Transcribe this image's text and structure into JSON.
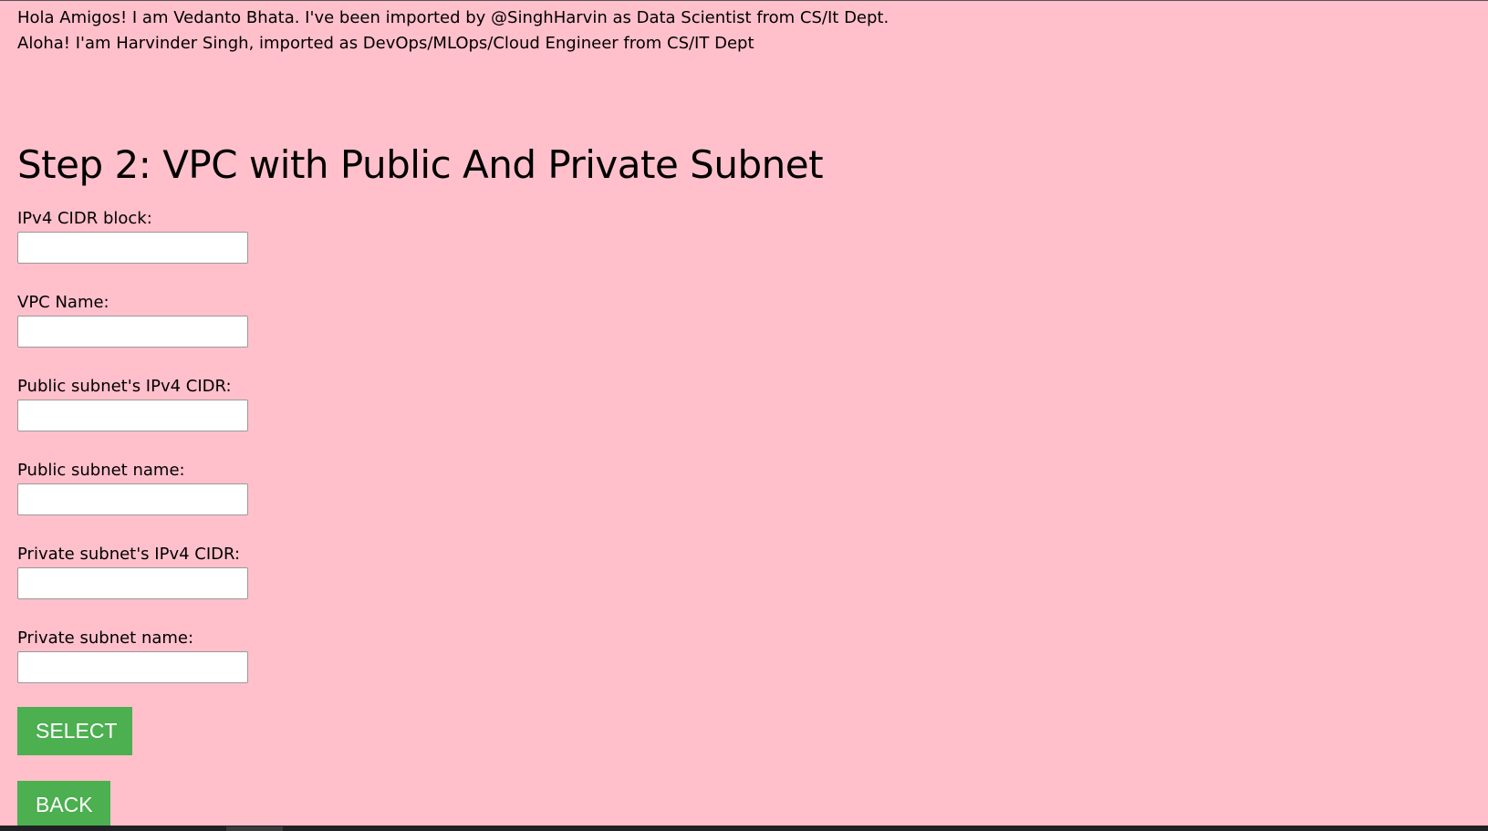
{
  "intro": {
    "line1": "Hola Amigos! I am Vedanto Bhata. I've been imported by @SinghHarvin as Data Scientist from CS/It Dept.",
    "line2": "Aloha! I'am Harvinder Singh, imported as DevOps/MLOps/Cloud Engineer from CS/IT Dept"
  },
  "page_title": "Step 2: VPC with Public And Private Subnet",
  "form": {
    "fields": [
      {
        "label": "IPv4 CIDR block:",
        "value": "",
        "placeholder": ""
      },
      {
        "label": "VPC Name:",
        "value": "",
        "placeholder": ""
      },
      {
        "label": "Public subnet's IPv4 CIDR:",
        "value": "",
        "placeholder": ""
      },
      {
        "label": "Public subnet name:",
        "value": "",
        "placeholder": ""
      },
      {
        "label": "Private subnet's IPv4 CIDR:",
        "value": "",
        "placeholder": ""
      },
      {
        "label": "Private subnet name:",
        "value": "",
        "placeholder": ""
      }
    ]
  },
  "buttons": {
    "select_label": "SELECT",
    "back_label": "BACK"
  },
  "colors": {
    "background": "#ffc0cb",
    "button": "#4caf50"
  }
}
